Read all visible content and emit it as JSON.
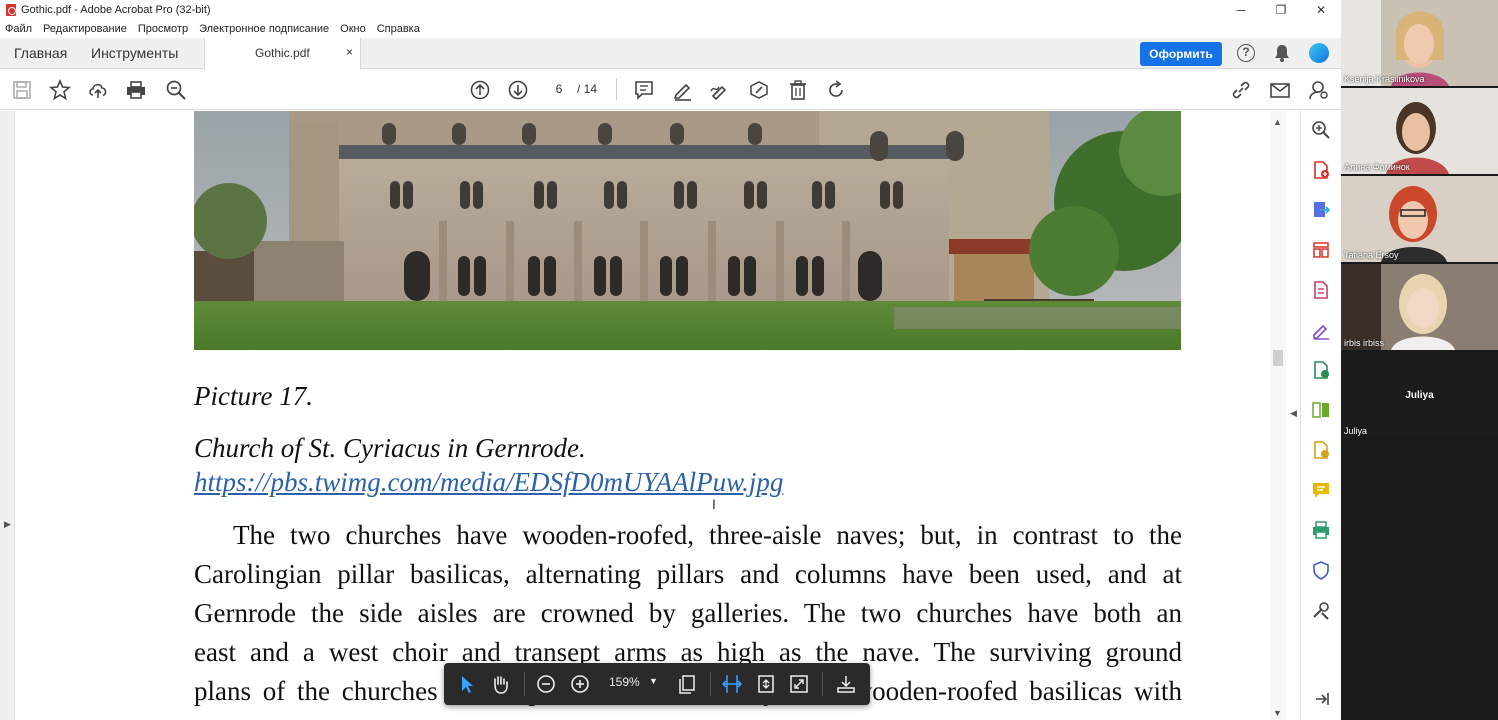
{
  "window": {
    "title": "Gothic.pdf - Adobe Acrobat Pro (32-bit)",
    "minimize": "─",
    "maximize": "❐",
    "close": "✕"
  },
  "menu": [
    "Файл",
    "Редактирование",
    "Просмотр",
    "Электронное подписание",
    "Окно",
    "Справка"
  ],
  "tabs": {
    "home": "Главная",
    "tools": "Инструменты",
    "doc_name": "Gothic.pdf",
    "doc_close": "×"
  },
  "header": {
    "action_button": "Оформить",
    "help": "?"
  },
  "toolbar": {
    "page_current": "6",
    "page_total": "/ 14"
  },
  "document": {
    "caption_picture": "Picture 17.",
    "caption_church": "Church of St. Cyriacus in Gernrode.",
    "caption_link": "https://pbs.twimg.com/media/EDSfD0mUYAAlPuw.jpg",
    "body_lines": [
      "The two churches have wooden-roofed, three-aisle naves; but, in contrast to the",
      "Carolingian pillar basilicas, alternating pillars and columns have been used, and at",
      "Gernrode the side aisles are crowned by galleries. The two churches have both an",
      "east and a west choir and transept arms as high as the nave. The surviving ground",
      "plans of the churches of the period show that they were wooden-roofed basilicas with"
    ]
  },
  "floating_toolbar": {
    "zoom": "159%"
  },
  "call": {
    "participants": [
      {
        "name": "Ksenija Krasilnikova"
      },
      {
        "name": "Алина Фоминок"
      },
      {
        "name": "Tatiana Ersoy"
      },
      {
        "name": "irbis irbiss"
      },
      {
        "name": "Juliya",
        "center": "Juliya"
      }
    ]
  },
  "colors": {
    "accent": "#1473e6",
    "link": "#2a61a8",
    "floatbar": "#2a2a2a",
    "floatbar_active": "#3aa0ff"
  }
}
